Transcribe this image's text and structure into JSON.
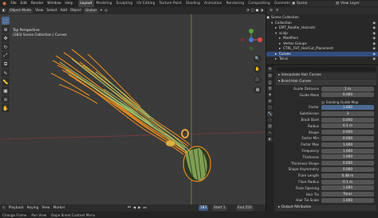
{
  "topbar": {
    "menus": [
      "File",
      "Edit",
      "Render",
      "Window",
      "Help"
    ],
    "workspaces": [
      "Layout",
      "Modeling",
      "Sculpting",
      "UV Editing",
      "Texture Paint",
      "Shading",
      "Animation",
      "Rendering",
      "Compositing",
      "Geometry Nodes",
      "Scripti"
    ],
    "active_workspace": "Layout",
    "scene": "Scene",
    "view_layer": "View Layer"
  },
  "viewport": {
    "mode": "Object Mode",
    "menus": [
      "View",
      "Select",
      "Add",
      "Object"
    ],
    "transform": "Global",
    "line1": "Top Perspective",
    "line2": "(183) Scene Collection | Curves"
  },
  "timeline": {
    "menus": [
      "Playback",
      "Keying",
      "View",
      "Marker"
    ],
    "current_frame": "183",
    "start_label": "Start",
    "start_value": "1",
    "end_label": "End",
    "end_value": "250"
  },
  "statusbar": {
    "items": [
      "Change Frame",
      "Pan View",
      "Dope Sheet Context Menu"
    ]
  },
  "outliner": {
    "root": "Scene Collection",
    "rows": [
      {
        "label": "Collection",
        "indent": 1,
        "icon": "▾",
        "selected": false
      },
      {
        "label": "EMT_Realtor_Haircuts",
        "indent": 2,
        "icon": "▸",
        "selected": false
      },
      {
        "label": "scalp",
        "indent": 2,
        "icon": "▾",
        "selected": false
      },
      {
        "label": "Modifiers",
        "indent": 3,
        "icon": "▸",
        "selected": false
      },
      {
        "label": "Vertex Groups",
        "indent": 3,
        "icon": "▸",
        "selected": false
      },
      {
        "label": "CTRL_FHT_HairCut_Placement",
        "indent": 3,
        "icon": "▸",
        "selected": false
      },
      {
        "label": "Curves",
        "indent": 2,
        "icon": "▸",
        "selected": true
      },
      {
        "label": "Torus",
        "indent": 2,
        "icon": "▸",
        "selected": false
      }
    ]
  },
  "properties": {
    "header_left": "Curves",
    "modifier_name": "Interpolate Hair Curves",
    "group_name": "Braid Hair Curves",
    "rows": [
      {
        "label": "Guide Distance",
        "value": "1 m",
        "type": "field"
      },
      {
        "label": "Guide Mask",
        "value": "0.000",
        "type": "field"
      },
      {
        "label": "",
        "value": "Existing Guide Map",
        "type": "check"
      },
      {
        "label": "Factor",
        "value": "1.000",
        "type": "blue"
      },
      {
        "label": "Subdivision",
        "value": "3",
        "type": "field"
      },
      {
        "label": "Braid Start",
        "value": "0.000",
        "type": "field"
      },
      {
        "label": "Radius",
        "value": "0.1 m",
        "type": "field"
      },
      {
        "label": "Shape",
        "value": "0.000",
        "type": "field"
      },
      {
        "label": "Factor Min",
        "value": "0.000",
        "type": "field"
      },
      {
        "label": "Factor Max",
        "value": "1.000",
        "type": "field"
      },
      {
        "label": "Frequency",
        "value": "1.000",
        "type": "field"
      },
      {
        "label": "Thickness",
        "value": "1.000",
        "type": "field"
      },
      {
        "label": "Thickness Shape",
        "value": "0.000",
        "type": "field"
      },
      {
        "label": "Shape Asymmetry",
        "value": "0.000",
        "type": "field"
      },
      {
        "label": "Flare Length",
        "value": "0.48 m",
        "type": "field"
      },
      {
        "label": "Flare Radius",
        "value": "0.1 m",
        "type": "field"
      },
      {
        "label": "Flare Opening",
        "value": "1.000",
        "type": "field"
      },
      {
        "label": "Hair Tie",
        "value": "Torus",
        "type": "field"
      },
      {
        "label": "Hair Tie Scale",
        "value": "1.000",
        "type": "field"
      }
    ],
    "footer": "Output Attributes"
  }
}
